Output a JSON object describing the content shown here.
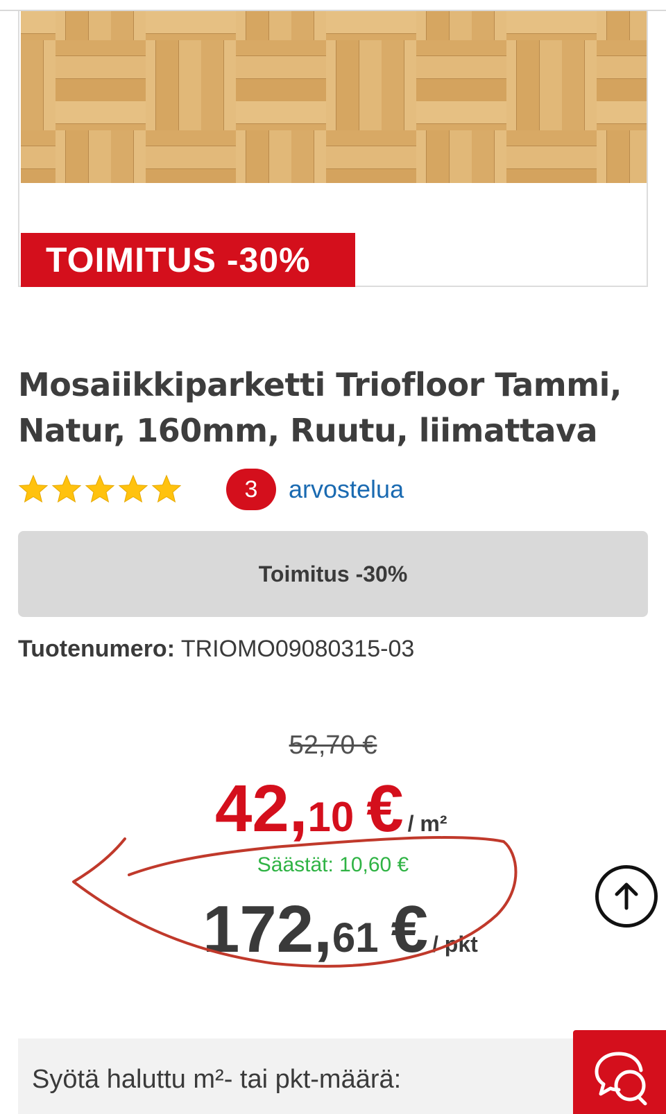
{
  "product": {
    "image_alt": "Mosaiikkiparketti tammi",
    "promo_ribbon": "TOIMITUS -30%",
    "title": "Mosaiikkiparketti Triofloor Tammi, Natur, 160mm, Ruutu, liimattava"
  },
  "rating": {
    "stars": 5,
    "max_stars": 5,
    "review_count": "3",
    "review_link": "arvostelua",
    "star_color": "#ffc20e"
  },
  "promo_button": {
    "label": "Toimitus -30%"
  },
  "sku": {
    "label": "Tuotenumero:",
    "value": "TRIOMO09080315-03"
  },
  "price": {
    "old": "52,70 €",
    "main_int": "42,",
    "main_dec": "10",
    "currency": "€",
    "main_unit": "/ m²",
    "savings": "Säästät: 10,60 €",
    "pkt_int": "172,",
    "pkt_dec": "61",
    "pkt_unit": "/ pkt"
  },
  "quantity": {
    "label": "Syötä haluttu m²- tai pkt-määrä:"
  },
  "icons": {
    "scroll_top": "arrow-up-icon",
    "chat": "chat-bubbles-icon"
  },
  "colors": {
    "brand_red": "#d40f1c",
    "link_blue": "#1a6ab1",
    "savings_green": "#2fb344",
    "annotation_red": "#c0392b"
  }
}
